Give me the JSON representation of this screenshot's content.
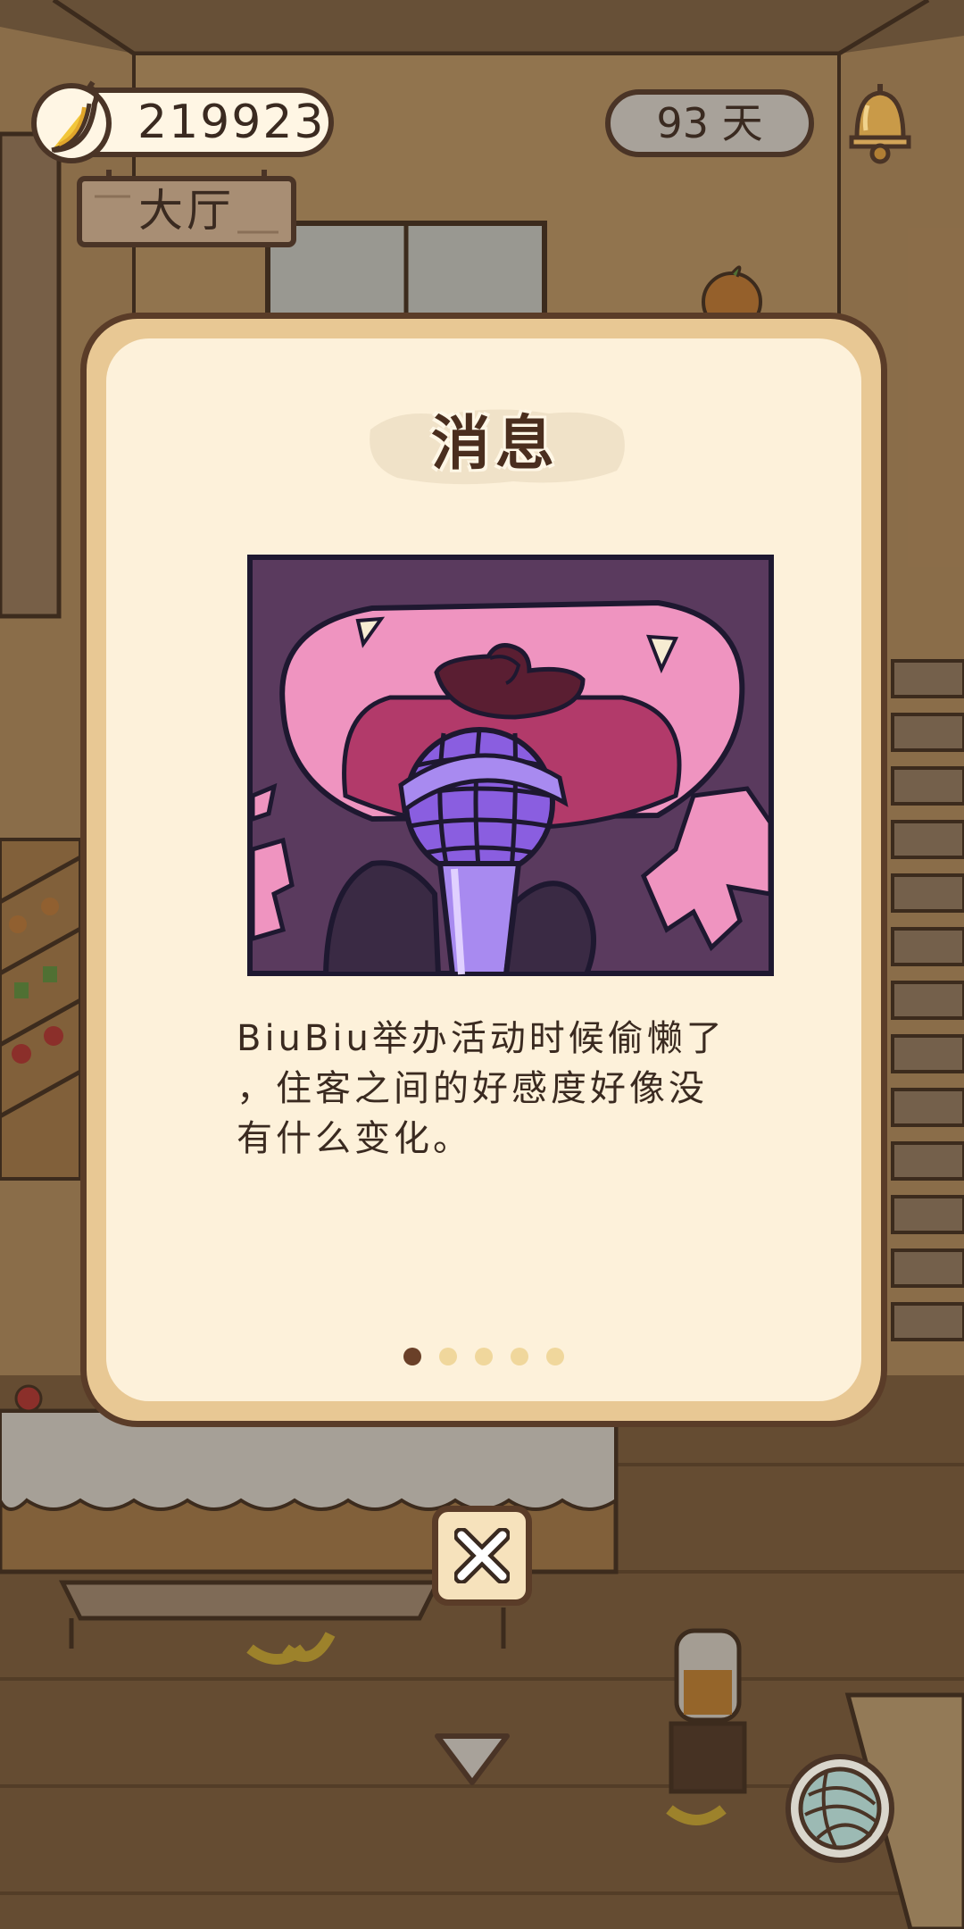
{
  "hud": {
    "currency_icon": "banana-icon",
    "currency_value": "219923",
    "room_name": "大厅",
    "days": "93 天",
    "notification_icon": "bell-icon"
  },
  "modal": {
    "title": "消息",
    "illustration": "singing-microphone-illustration",
    "message": "BiuBiu举办活动时候偷懒了\n，住客之间的好感度好像没\n有什么变化。",
    "page_count": 5,
    "active_page": 1
  },
  "controls": {
    "close_icon": "close-icon",
    "scroll_icon": "chevron-down-icon",
    "yarn_icon": "yarn-ball-icon"
  },
  "colors": {
    "panel_border": "#5a3c28",
    "panel_outer": "#e8c894",
    "panel_inner": "#fdf1da",
    "pager_active": "#6a4028",
    "pager_inactive": "#f0d79c"
  }
}
